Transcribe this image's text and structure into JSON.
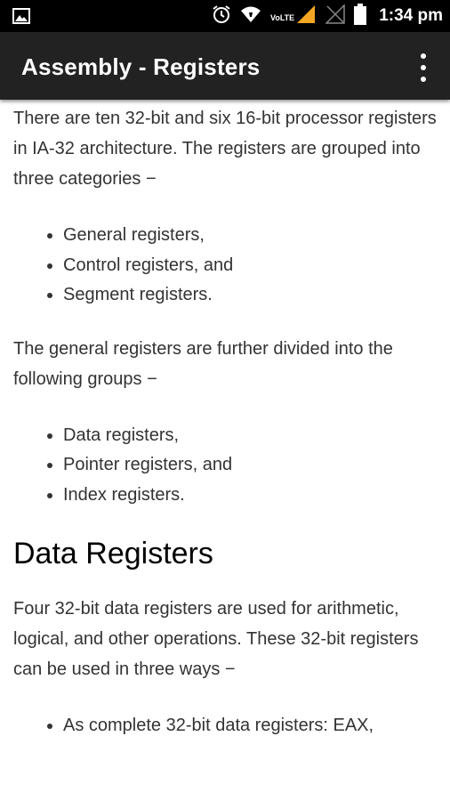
{
  "status_bar": {
    "time": "1:34 pm",
    "network_label": "VoLTE",
    "icons": [
      "image-notification-icon",
      "alarm-clock-icon",
      "wifi-icon",
      "volte-signal-icon",
      "signal-icon",
      "battery-icon"
    ]
  },
  "app_bar": {
    "title": "Assembly - Registers",
    "menu_icon": "more-vert-icon"
  },
  "content": {
    "intro": "There are ten 32-bit and six 16-bit processor registers in IA-32 architecture. The registers are grouped into three categories −",
    "categories": [
      "General registers,",
      "Control registers, and",
      "Segment registers."
    ],
    "general_intro": "The general registers are further divided into the following groups −",
    "groups": [
      "Data registers,",
      "Pointer registers, and",
      "Index registers."
    ],
    "heading": "Data Registers",
    "data_intro": "Four 32-bit data registers are used for arithmetic, logical, and other operations. These 32-bit registers can be used in three ways −",
    "ways": [
      "As complete 32-bit data registers: EAX,"
    ]
  },
  "colors": {
    "status_bar_bg": "#000000",
    "app_bar_bg": "#222222",
    "body_text": "#333333",
    "signal_accent": "#F5A623"
  }
}
